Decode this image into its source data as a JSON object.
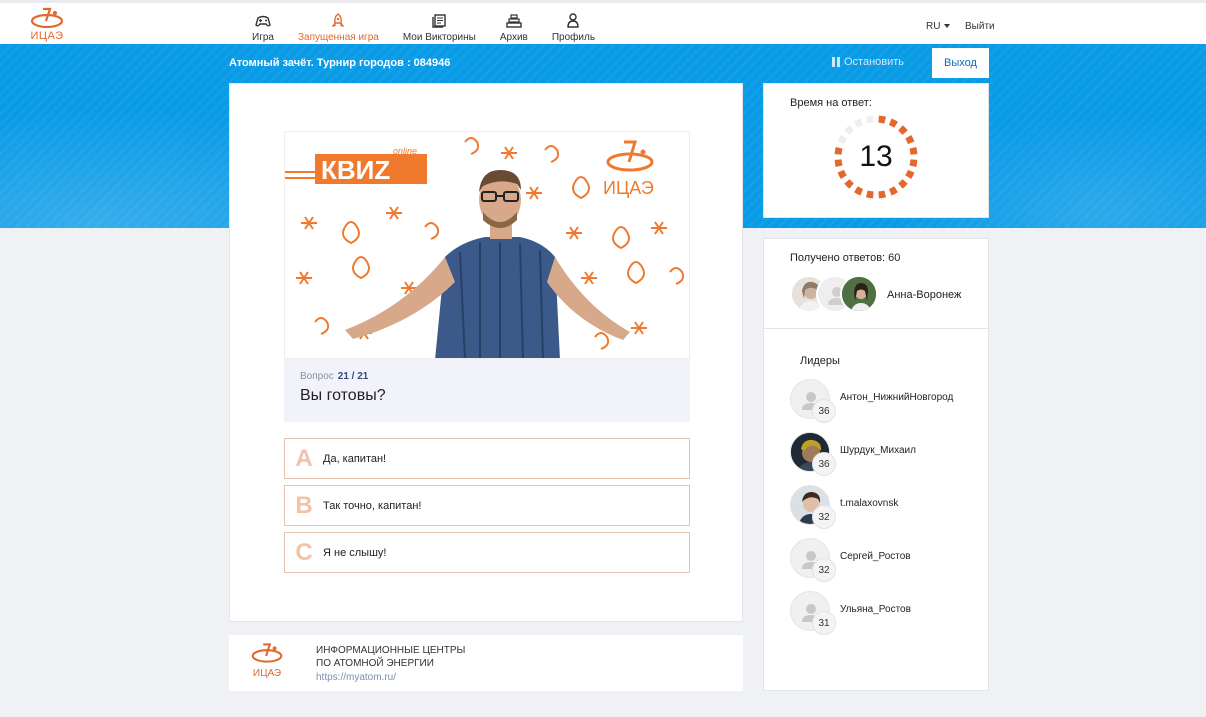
{
  "brand": {
    "logo_text": "ИЦАЭ",
    "accent": "#e2682d",
    "blue": "#0a9be7"
  },
  "nav": {
    "items": [
      {
        "label": "Игра",
        "icon": "gamepad-icon"
      },
      {
        "label": "Запущенная игра",
        "icon": "rocket-icon",
        "active": true
      },
      {
        "label": "Мои Викторины",
        "icon": "quiz-list-icon"
      },
      {
        "label": "Архив",
        "icon": "archive-icon"
      },
      {
        "label": "Профиль",
        "icon": "person-icon"
      }
    ],
    "lang": "RU",
    "logout": "Выйти"
  },
  "game": {
    "title": "Атомный зачёт. Турнир городов : 084946",
    "stop_label": "Остановить",
    "exit_label": "Выход"
  },
  "question": {
    "image_banner": "КВИZ",
    "image_online": "online",
    "image_logo": "ИЦАЭ",
    "label": "Вопрос",
    "number": "21 / 21",
    "text": "Вы готовы?",
    "answers": [
      {
        "letter": "A",
        "text": "Да, капитан!"
      },
      {
        "letter": "B",
        "text": "Так точно, капитан!"
      },
      {
        "letter": "C",
        "text": "Я не слышу!"
      }
    ]
  },
  "footer": {
    "logo_text": "ИЦАЭ",
    "line1": "ИНФОРМАЦИОННЫЕ ЦЕНТРЫ",
    "line2": "ПО АТОМНОЙ ЭНЕРГИИ",
    "link": "https://myatom.ru/"
  },
  "timer": {
    "label": "Время на ответ:",
    "value": "13",
    "remaining_fraction": 0.8
  },
  "responses": {
    "label": "Получено ответов: 60",
    "last_name": "Анна-Воронеж"
  },
  "leaders": {
    "title": "Лидеры",
    "items": [
      {
        "name": "Антон_НижнийНовгород",
        "score": "36",
        "photo": false
      },
      {
        "name": "Шурдук_Михаил",
        "score": "36",
        "photo": true
      },
      {
        "name": "t.malaxovnsk",
        "score": "32",
        "photo": true
      },
      {
        "name": "Сергей_Ростов",
        "score": "32",
        "photo": false
      },
      {
        "name": "Ульяна_Ростов",
        "score": "31",
        "photo": false
      }
    ]
  }
}
